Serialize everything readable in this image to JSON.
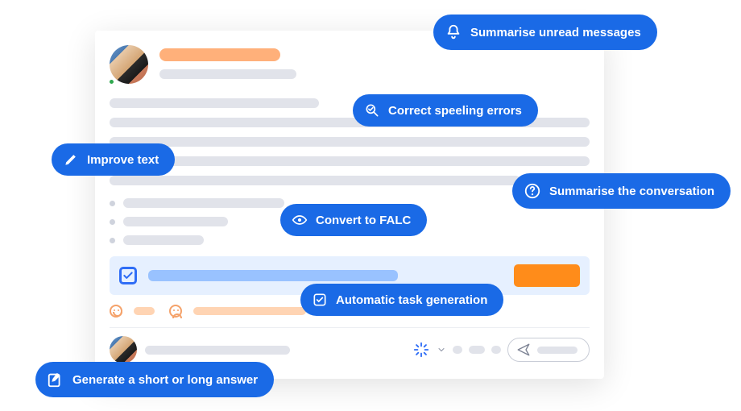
{
  "pills": {
    "summarise_unread": "Summarise unread messages",
    "correct_spelling": "Correct speeling errors",
    "improve_text": "Improve text",
    "summarise_conversation": "Summarise the conversation",
    "convert_falc": "Convert to FALC",
    "auto_task": "Automatic task generation",
    "generate_answer": "Generate a short or long answer"
  }
}
